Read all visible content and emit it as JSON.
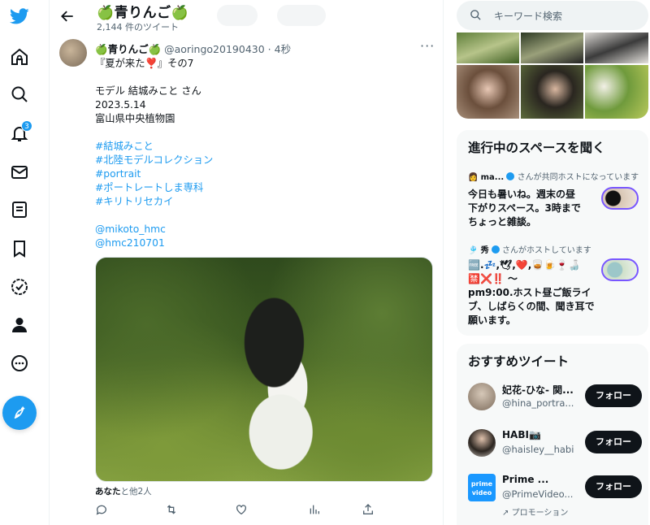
{
  "nav": {
    "notification_count": "3"
  },
  "header": {
    "title": "🍏青りんご🍏",
    "tweet_count": "2,144 件のツイート"
  },
  "tweet": {
    "display_name": "🍏青りんご🍏",
    "handle": "@aoringo20190430",
    "time": "· 4秒",
    "more": "···",
    "lines": [
      "『夏が来た❣️』その7",
      "",
      "モデル 結城みこと さん",
      "2023.5.14",
      "富山県中央植物園",
      ""
    ],
    "hashtags": [
      "#結城みこと",
      "#北陸モデルコレクション",
      "#portrait",
      "#ポートレートしま専科",
      "#キリトリセカイ"
    ],
    "mentions": [
      "@mikoto_hmc",
      "@hmc210701"
    ],
    "liked_by_you": "あなた",
    "liked_by_rest": "と他2人"
  },
  "right": {
    "search_placeholder": "キーワード検索",
    "spaces": {
      "title": "進行中のスペースを聞く",
      "items": [
        {
          "host_name": "ma...",
          "host_role": "さんが共同ホストになっています",
          "text_lines": [
            "今日も暑いね。週末の昼",
            "下がりスペース。3時まで",
            "ちょっと雑談。"
          ]
        },
        {
          "host_name": "秀",
          "host_role": "さんがホストしています",
          "text_lines": [
            "🆓.💤,🕊,❤️,🥃🍺🍷🍶",
            "🈲❌‼️ 〜",
            "pm9:00.ホスト昼ご飯ライ",
            "ブ、しばらくの間、聞き耳で",
            "願います。"
          ]
        }
      ]
    },
    "recommend": {
      "title": "おすすめツイート",
      "follow_label": "フォロー",
      "items": [
        {
          "name": "妃花-ひな- 関...",
          "handle": "@hina_portra..."
        },
        {
          "name": "HABI📷",
          "handle": "@haisley__habi"
        },
        {
          "name": "Prime ...",
          "handle": "@PrimeVideo...",
          "promo": "プロモーション",
          "logo_line1": "prime",
          "logo_line2": "video"
        }
      ]
    }
  }
}
